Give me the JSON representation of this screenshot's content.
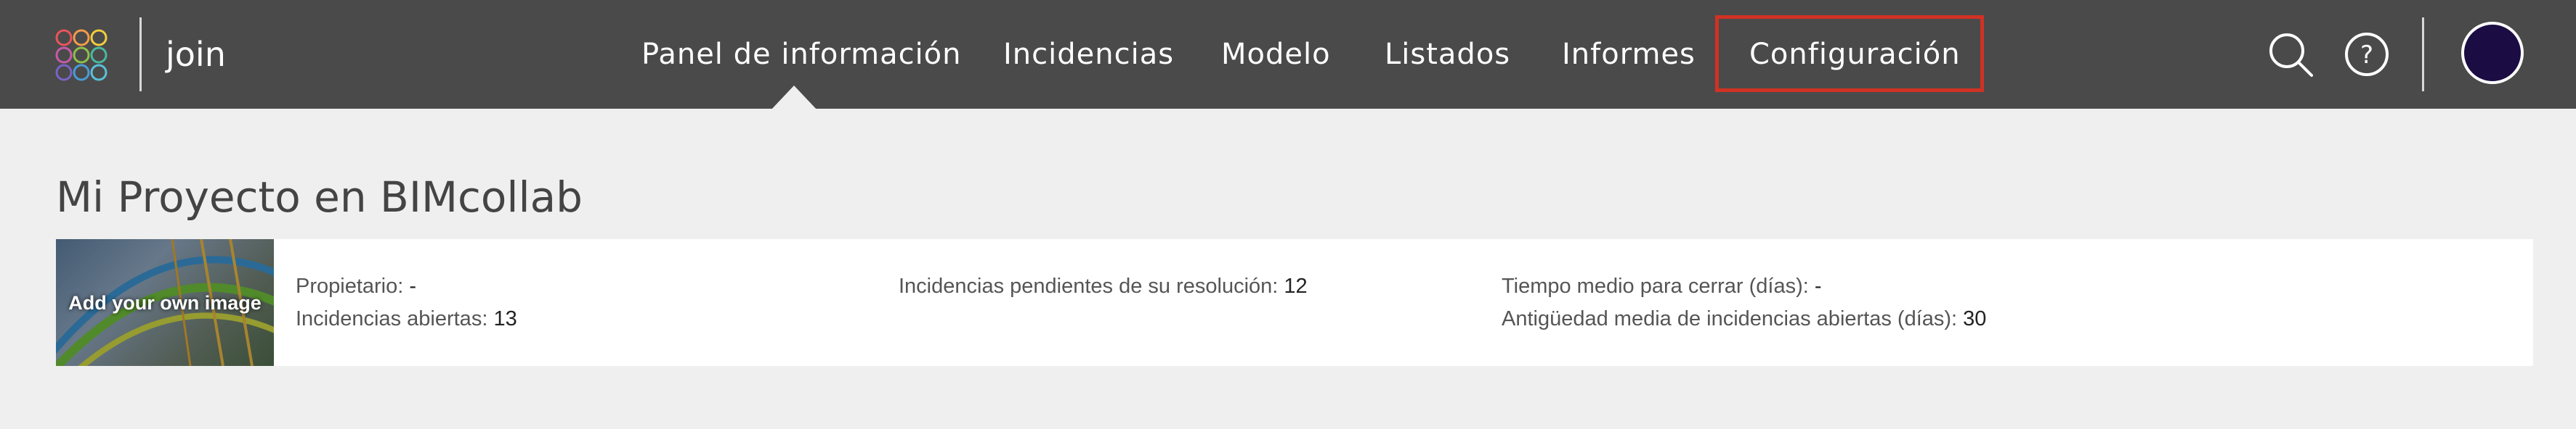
{
  "app": {
    "name": "join"
  },
  "nav": {
    "items": [
      {
        "label": "Panel de información",
        "active": true
      },
      {
        "label": "Incidencias"
      },
      {
        "label": "Modelo"
      },
      {
        "label": "Listados"
      },
      {
        "label": "Informes"
      },
      {
        "label": "Configuración",
        "highlighted": true
      }
    ]
  },
  "header_icons": {
    "search": "search-icon",
    "help": "help-icon",
    "avatar": "avatar"
  },
  "colors": {
    "topbar": "#4a4a4a",
    "highlight": "#d03224",
    "avatar": "#1c0c44",
    "background": "#efefef"
  },
  "project": {
    "title": "Mi Proyecto en BIMcollab",
    "image_prompt": "Add your own image",
    "owner_label": "Propietario:",
    "owner_value": "-",
    "open_issues_label": "Incidencias abiertas:",
    "open_issues_value": "13",
    "pending_label": "Incidencias pendientes de su resolución:",
    "pending_value": "12",
    "avg_close_label": "Tiempo medio para cerrar (días):",
    "avg_close_value": "-",
    "avg_age_label": "Antigüedad media de incidencias abiertas (días):",
    "avg_age_value": "30"
  }
}
